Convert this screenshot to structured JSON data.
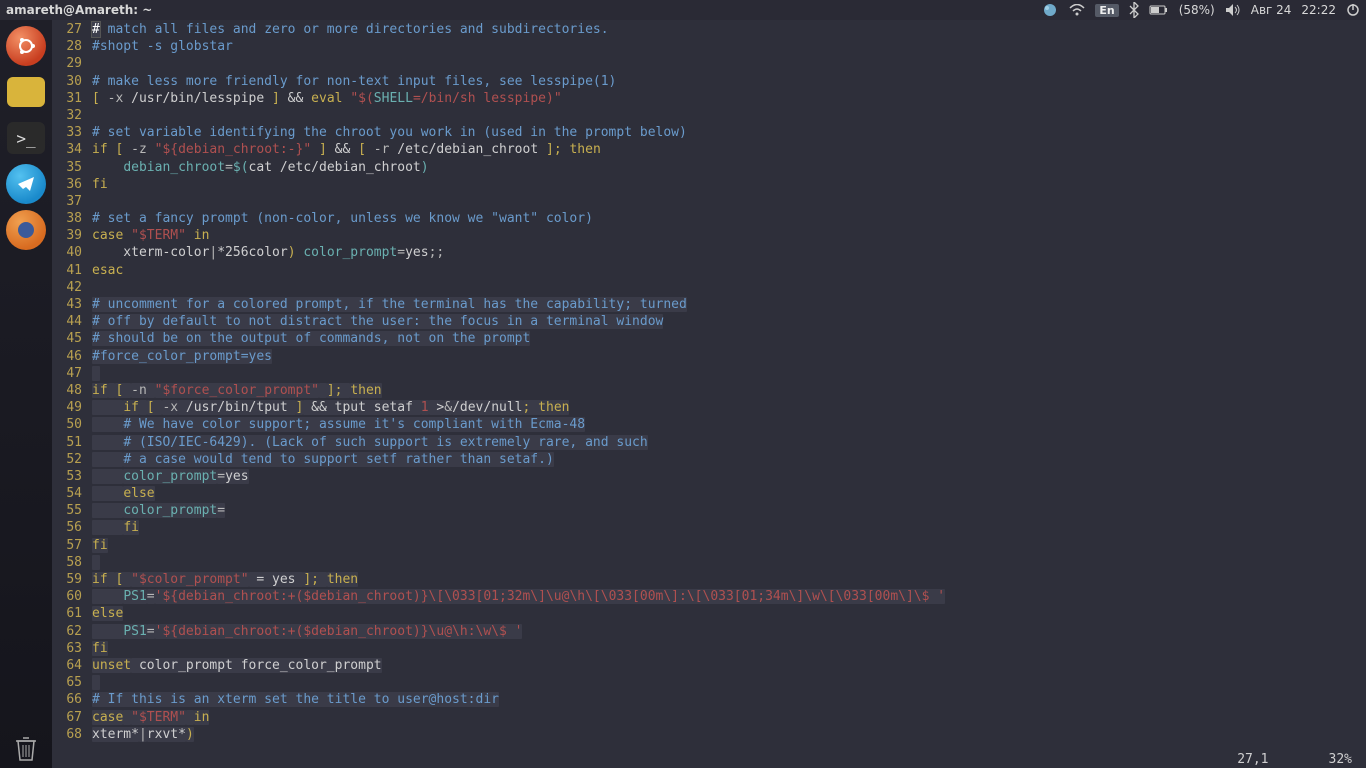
{
  "topbar": {
    "title": "amareth@Amareth: ~",
    "lang": "En",
    "battery": "(58%)",
    "date": "Авг 24",
    "time": "22:22"
  },
  "dock": {
    "ubuntu": "ubuntu-logo",
    "files": "file-manager",
    "terminal": "terminal",
    "telegram": "telegram",
    "firefox": "firefox",
    "trash": "trash"
  },
  "status": {
    "pos": "27,1",
    "pct": "32%"
  },
  "lines": [
    {
      "n": 27,
      "hl": false,
      "cursor": true,
      "seg": [
        [
          "c-comment",
          "# match all files and zero or more directories and subdirectories."
        ]
      ]
    },
    {
      "n": 28,
      "hl": false,
      "seg": [
        [
          "c-comment",
          "#shopt -s globstar"
        ]
      ]
    },
    {
      "n": 29,
      "hl": false,
      "seg": []
    },
    {
      "n": 30,
      "hl": false,
      "seg": [
        [
          "c-comment",
          "# make less more friendly for non-text input files, see lesspipe(1)"
        ]
      ]
    },
    {
      "n": 31,
      "hl": false,
      "seg": [
        [
          "c-keyword",
          "[ "
        ],
        [
          "c-op",
          "-x"
        ],
        [
          "c-plain",
          " /usr/bin/lesspipe "
        ],
        [
          "c-keyword",
          "]"
        ],
        [
          "c-plain",
          " && "
        ],
        [
          "c-keyword",
          "eval"
        ],
        [
          "c-plain",
          " "
        ],
        [
          "c-string",
          "\"$("
        ],
        [
          "c-var",
          "SHELL"
        ],
        [
          "c-string",
          "=/bin/sh lesspipe)\""
        ]
      ]
    },
    {
      "n": 32,
      "hl": false,
      "seg": []
    },
    {
      "n": 33,
      "hl": false,
      "seg": [
        [
          "c-comment",
          "# set variable identifying the chroot you work in (used in the prompt below)"
        ]
      ]
    },
    {
      "n": 34,
      "hl": false,
      "seg": [
        [
          "c-keyword",
          "if"
        ],
        [
          "c-plain",
          " "
        ],
        [
          "c-keyword",
          "[ "
        ],
        [
          "c-op",
          "-z"
        ],
        [
          "c-plain",
          " "
        ],
        [
          "c-string",
          "\"${debian_chroot:-}\""
        ],
        [
          "c-plain",
          " "
        ],
        [
          "c-keyword",
          "]"
        ],
        [
          "c-plain",
          " && "
        ],
        [
          "c-keyword",
          "[ "
        ],
        [
          "c-op",
          "-r"
        ],
        [
          "c-plain",
          " /etc/debian_chroot "
        ],
        [
          "c-keyword",
          "]; "
        ],
        [
          "c-keyword",
          "then"
        ]
      ]
    },
    {
      "n": 35,
      "hl": false,
      "seg": [
        [
          "c-plain",
          "    "
        ],
        [
          "c-var",
          "debian_chroot"
        ],
        [
          "c-op",
          "="
        ],
        [
          "c-var",
          "$("
        ],
        [
          "c-plain",
          "cat /etc/debian_chroot"
        ],
        [
          "c-var",
          ")"
        ]
      ]
    },
    {
      "n": 36,
      "hl": false,
      "seg": [
        [
          "c-keyword",
          "fi"
        ]
      ]
    },
    {
      "n": 37,
      "hl": false,
      "seg": []
    },
    {
      "n": 38,
      "hl": false,
      "seg": [
        [
          "c-comment",
          "# set a fancy prompt (non-color, unless we know we \"want\" color)"
        ]
      ]
    },
    {
      "n": 39,
      "hl": false,
      "seg": [
        [
          "c-keyword",
          "case"
        ],
        [
          "c-plain",
          " "
        ],
        [
          "c-string",
          "\"$TERM\""
        ],
        [
          "c-plain",
          " "
        ],
        [
          "c-keyword",
          "in"
        ]
      ]
    },
    {
      "n": 40,
      "hl": false,
      "seg": [
        [
          "c-plain",
          "    xterm-color"
        ],
        [
          "c-op",
          "|"
        ],
        [
          "c-plain",
          "*256color"
        ],
        [
          "c-keyword",
          ")"
        ],
        [
          "c-plain",
          " "
        ],
        [
          "c-var",
          "color_prompt"
        ],
        [
          "c-op",
          "="
        ],
        [
          "c-plain",
          "yes"
        ],
        [
          "c-op",
          ";;"
        ]
      ]
    },
    {
      "n": 41,
      "hl": false,
      "seg": [
        [
          "c-keyword",
          "esac"
        ]
      ]
    },
    {
      "n": 42,
      "hl": false,
      "seg": []
    },
    {
      "n": 43,
      "hl": true,
      "seg": [
        [
          "c-comment",
          "# uncomment for a colored prompt, if the terminal has the capability; turned"
        ]
      ]
    },
    {
      "n": 44,
      "hl": true,
      "seg": [
        [
          "c-comment",
          "# off by default to not distract the user: the focus in a terminal window"
        ]
      ]
    },
    {
      "n": 45,
      "hl": true,
      "seg": [
        [
          "c-comment",
          "# should be on the output of commands, not on the prompt"
        ]
      ]
    },
    {
      "n": 46,
      "hl": true,
      "seg": [
        [
          "c-comment",
          "#force_color_prompt=yes"
        ]
      ]
    },
    {
      "n": 47,
      "hl": true,
      "seg": []
    },
    {
      "n": 48,
      "hl": true,
      "seg": [
        [
          "c-keyword",
          "if"
        ],
        [
          "c-plain",
          " "
        ],
        [
          "c-keyword",
          "[ "
        ],
        [
          "c-op",
          "-n"
        ],
        [
          "c-plain",
          " "
        ],
        [
          "c-string",
          "\"$force_color_prompt\""
        ],
        [
          "c-plain",
          " "
        ],
        [
          "c-keyword",
          "]; "
        ],
        [
          "c-keyword",
          "then"
        ]
      ]
    },
    {
      "n": 49,
      "hl": true,
      "seg": [
        [
          "c-plain",
          "    "
        ],
        [
          "c-keyword",
          "if"
        ],
        [
          "c-plain",
          " "
        ],
        [
          "c-keyword",
          "[ "
        ],
        [
          "c-op",
          "-x"
        ],
        [
          "c-plain",
          " /usr/bin/tput "
        ],
        [
          "c-keyword",
          "]"
        ],
        [
          "c-plain",
          " && tput setaf "
        ],
        [
          "c-num",
          "1"
        ],
        [
          "c-plain",
          " >"
        ],
        [
          "c-op",
          "&"
        ],
        [
          "c-plain",
          "/dev/null"
        ],
        [
          "c-keyword",
          "; then"
        ]
      ]
    },
    {
      "n": 50,
      "hl": true,
      "seg": [
        [
          "c-plain",
          "    "
        ],
        [
          "c-comment",
          "# We have color support; assume it's compliant with Ecma-48"
        ]
      ]
    },
    {
      "n": 51,
      "hl": true,
      "seg": [
        [
          "c-plain",
          "    "
        ],
        [
          "c-comment",
          "# (ISO/IEC-6429). (Lack of such support is extremely rare, and such"
        ]
      ]
    },
    {
      "n": 52,
      "hl": true,
      "seg": [
        [
          "c-plain",
          "    "
        ],
        [
          "c-comment",
          "# a case would tend to support setf rather than setaf.)"
        ]
      ]
    },
    {
      "n": 53,
      "hl": true,
      "seg": [
        [
          "c-plain",
          "    "
        ],
        [
          "c-var",
          "color_prompt"
        ],
        [
          "c-op",
          "="
        ],
        [
          "c-plain",
          "yes"
        ]
      ]
    },
    {
      "n": 54,
      "hl": true,
      "seg": [
        [
          "c-plain",
          "    "
        ],
        [
          "c-keyword",
          "else"
        ]
      ]
    },
    {
      "n": 55,
      "hl": true,
      "seg": [
        [
          "c-plain",
          "    "
        ],
        [
          "c-var",
          "color_prompt"
        ],
        [
          "c-op",
          "="
        ]
      ]
    },
    {
      "n": 56,
      "hl": true,
      "seg": [
        [
          "c-plain",
          "    "
        ],
        [
          "c-keyword",
          "fi"
        ]
      ]
    },
    {
      "n": 57,
      "hl": true,
      "seg": [
        [
          "c-keyword",
          "fi"
        ]
      ]
    },
    {
      "n": 58,
      "hl": true,
      "seg": []
    },
    {
      "n": 59,
      "hl": true,
      "seg": [
        [
          "c-keyword",
          "if"
        ],
        [
          "c-plain",
          " "
        ],
        [
          "c-keyword",
          "[ "
        ],
        [
          "c-string",
          "\"$color_prompt\""
        ],
        [
          "c-plain",
          " = yes "
        ],
        [
          "c-keyword",
          "]; "
        ],
        [
          "c-keyword",
          "then"
        ]
      ]
    },
    {
      "n": 60,
      "hl": true,
      "seg": [
        [
          "c-plain",
          "    "
        ],
        [
          "c-var",
          "PS1"
        ],
        [
          "c-op",
          "="
        ],
        [
          "c-string",
          "'${debian_chroot:+($debian_chroot)}\\[\\033[01;32m\\]\\u@\\h\\[\\033[00m\\]:\\[\\033[01;34m\\]\\w\\[\\033[00m\\]\\$ '"
        ]
      ]
    },
    {
      "n": 61,
      "hl": true,
      "seg": [
        [
          "c-keyword",
          "else"
        ]
      ]
    },
    {
      "n": 62,
      "hl": true,
      "seg": [
        [
          "c-plain",
          "    "
        ],
        [
          "c-var",
          "PS1"
        ],
        [
          "c-op",
          "="
        ],
        [
          "c-string",
          "'${debian_chroot:+($debian_chroot)}\\u@\\h:\\w\\$ '"
        ]
      ]
    },
    {
      "n": 63,
      "hl": true,
      "seg": [
        [
          "c-keyword",
          "fi"
        ]
      ]
    },
    {
      "n": 64,
      "hl": true,
      "seg": [
        [
          "c-keyword",
          "unset"
        ],
        [
          "c-plain",
          " color_prompt force_color_prompt"
        ]
      ]
    },
    {
      "n": 65,
      "hl": true,
      "seg": []
    },
    {
      "n": 66,
      "hl": true,
      "seg": [
        [
          "c-comment",
          "# If this is an xterm set the title to user@host:dir"
        ]
      ]
    },
    {
      "n": 67,
      "hl": true,
      "seg": [
        [
          "c-keyword",
          "case"
        ],
        [
          "c-plain",
          " "
        ],
        [
          "c-string",
          "\"$TERM\""
        ],
        [
          "c-plain",
          " "
        ],
        [
          "c-keyword",
          "in"
        ]
      ]
    },
    {
      "n": 68,
      "hl": true,
      "seg": [
        [
          "c-plain",
          "xterm*"
        ],
        [
          "c-op",
          "|"
        ],
        [
          "c-plain",
          "rxvt*"
        ],
        [
          "c-keyword",
          ")"
        ]
      ]
    }
  ]
}
